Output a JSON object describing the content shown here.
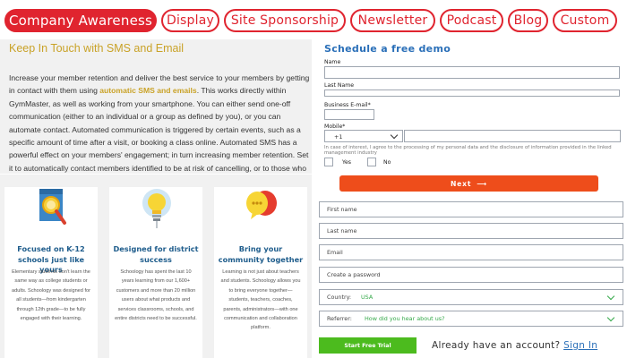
{
  "tabs": [
    {
      "label": "Company Awareness",
      "active": true
    },
    {
      "label": "Display",
      "active": false
    },
    {
      "label": "Site Sponsorship",
      "active": false
    },
    {
      "label": "Newsletter",
      "active": false
    },
    {
      "label": "Podcast",
      "active": false
    },
    {
      "label": "Blog",
      "active": false
    },
    {
      "label": "Custom",
      "active": false
    }
  ],
  "info": {
    "title": "Keep In Touch with SMS and Email",
    "para_start": "Increase your member retention and deliver the best service to your members by getting in contact with them using ",
    "highlight": "automatic SMS and emails",
    "para_end": ". This works directly within GymMaster, as well as working from your smartphone. You can either send one-off communication (either to an individual or a group as defined by you), or you can automate contact. Automated communication is triggered by certain events, such as a specific amount of time after a visit, or booking a class online. Automated SMS has a powerful effect on your members' engagement; in turn increasing member retention. Set it to automatically contact members identified to be at risk of cancelling, or to those who have not been keeping up to date with their payments."
  },
  "cards": [
    {
      "icon": "magnifier-icon",
      "title": "Focused on K-12 schools just like yours",
      "text": "Elementary students don't learn the same way as college students or adults. Schoology was designed for all students—from kindergarten through 12th grade—to be fully engaged with their learning."
    },
    {
      "icon": "lightbulb-icon",
      "title": "Designed for district success",
      "text": "Schoology has spent the last 10 years learning from our 1,600+ customers and more than 20 million users about what products and services classrooms, schools, and entire districts need to be successful."
    },
    {
      "icon": "speech-bubbles-icon",
      "title": "Bring your community together",
      "text": "Learning is not just about teachers and students. Schoology allows you to bring everyone together—students, teachers, coaches, parents, administrators—with one communication and collaboration platform."
    }
  ],
  "form": {
    "title": "Schedule a free demo",
    "name_label": "Name",
    "last_name_label": "Last Name",
    "business_email_label": "Business E-mail*",
    "mobile_label": "Mobile*",
    "mobile_code": "+1",
    "consent_text": "In case of interest, I agree to the processing of my personal data and the disclosure of information provided in the linked management industry",
    "yes_label": "Yes",
    "no_label": "No",
    "next_label": "Next",
    "next_arrow": "⟶",
    "first_name_placeholder": "First name",
    "last_name_placeholder": "Last name",
    "email_placeholder": "Email",
    "password_placeholder": "Create a password",
    "country_label": "Country:",
    "country_value": "USA",
    "referrer_label": "Referrer:",
    "referrer_value": "How did you hear about us?",
    "start_label": "Start Free Trial",
    "account_text": "Already have an account?",
    "signin_label": "Sign In"
  },
  "colors": {
    "tab_red": "#e0242f",
    "title_gold": "#c9a227",
    "card_title_blue": "#1f5d8c",
    "form_title_blue": "#2a6fb8",
    "next_orange": "#ee4d1b",
    "start_green": "#4cbb1e",
    "select_value_green": "#35a94a"
  }
}
